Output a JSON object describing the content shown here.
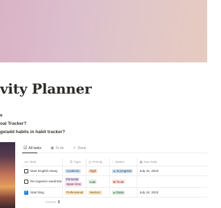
{
  "page": {
    "title": "vity Planner",
    "toggles": [
      "e",
      "oal Tracker?",
      "ge/add habits in habit tracker?"
    ]
  },
  "views": [
    {
      "label": "All tasks",
      "icon": "checklist-icon",
      "active": true
    },
    {
      "label": "To do",
      "icon": "circle-dot-icon",
      "active": false
    },
    {
      "label": "Done",
      "icon": "check-circle-icon",
      "active": false
    }
  ],
  "table": {
    "headers": {
      "task": "Task",
      "type": "Type",
      "priority": "Priority",
      "status": "Status",
      "due": "Due Date"
    },
    "rows": [
      {
        "checked": false,
        "task": "Start English essay",
        "types": [
          "Academic"
        ],
        "priority": "High",
        "status": "In progress",
        "due": "July 31, 2023"
      },
      {
        "checked": false,
        "task": "Re-organize wardrobe",
        "types": [
          "Personal",
          "Spare time"
        ],
        "priority": "Low",
        "status": "To do",
        "due": ""
      },
      {
        "checked": true,
        "task": "Start blog",
        "types": [
          "Professional"
        ],
        "priority": "Medium",
        "status": "Done",
        "due": "July 24, 2023"
      }
    ],
    "count_label": "COUNT",
    "count_value": "3"
  },
  "colors": {
    "Academic": {
      "bg": "#d3e5ef",
      "fg": "#28456c"
    },
    "Personal": {
      "bg": "#e8deee",
      "fg": "#492f64"
    },
    "Spare time": {
      "bg": "#f5e0e9",
      "fg": "#69314c"
    },
    "Professional": {
      "bg": "#fdecc8",
      "fg": "#6b4a12"
    },
    "High": {
      "bg": "#fadec9",
      "fg": "#6b3a14"
    },
    "Low": {
      "bg": "#dbeddb",
      "fg": "#1c3829"
    },
    "Medium": {
      "bg": "#fdecc8",
      "fg": "#6b4a12"
    },
    "In progress": {
      "bg": "#d3e5ef",
      "fg": "#183347",
      "dot": "#5b97bd"
    },
    "To do": {
      "bg": "#ffe2dd",
      "fg": "#5d1715",
      "dot": "#e16f64"
    },
    "Done": {
      "bg": "#dbeddb",
      "fg": "#1c3829",
      "dot": "#6c9b7d"
    }
  }
}
